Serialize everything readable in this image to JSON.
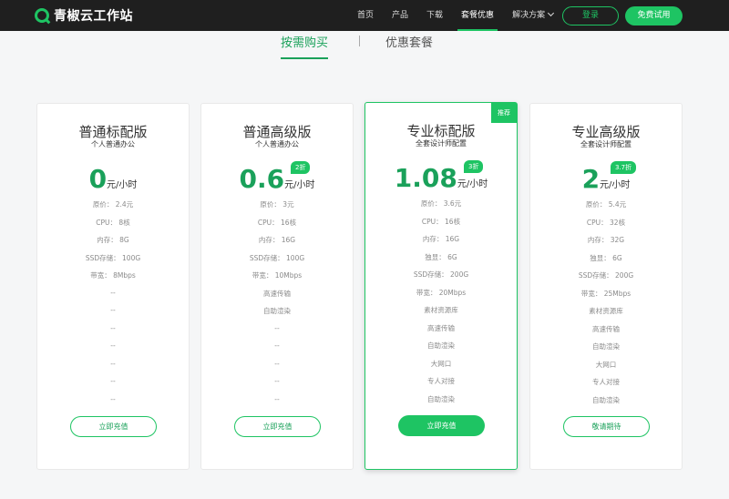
{
  "header": {
    "logo_text": "青椒云工作站",
    "nav": [
      "首页",
      "产品",
      "下载",
      "套餐优惠",
      "解决方案"
    ],
    "login": "登录",
    "trial": "免费试用"
  },
  "tabs": [
    "按需购买",
    "优惠套餐"
  ],
  "plans": [
    {
      "title": "普通标配版",
      "subtitle": "个人普通办公",
      "price": "0",
      "unit": "元/小时",
      "discount": "",
      "features": [
        "原价： 2.4元",
        "CPU： 8核",
        "内存： 8G",
        "SSD存储： 100G",
        "带宽： 8Mbps",
        "--",
        "--",
        "--",
        "--",
        "--",
        "--",
        "--"
      ],
      "button": "立即充值"
    },
    {
      "title": "普通高级版",
      "subtitle": "个人普通办公",
      "price": "0.6",
      "unit": "元/小时",
      "discount": "2折",
      "features": [
        "原价： 3元",
        "CPU： 16核",
        "内存： 16G",
        "SSD存储： 100G",
        "带宽： 10Mbps",
        "高速传输",
        "自助渲染",
        "--",
        "--",
        "--",
        "--",
        "--"
      ],
      "button": "立即充值"
    },
    {
      "title": "专业标配版",
      "subtitle": "全套设计师配置",
      "price": "1.08",
      "unit": "元/小时",
      "discount": "3折",
      "recommended": "推荐",
      "features": [
        "原价： 3.6元",
        "CPU： 16核",
        "内存： 16G",
        "独显： 6G",
        "SSD存储： 200G",
        "带宽： 20Mbps",
        "素材资源库",
        "高速传输",
        "自助渲染",
        "大网口",
        "专人对接",
        "自助渲染"
      ],
      "button": "立即充值"
    },
    {
      "title": "专业高级版",
      "subtitle": "全套设计师配置",
      "price": "2",
      "unit": "元/小时",
      "discount": "3.7折",
      "features": [
        "原价： 5.4元",
        "CPU： 32核",
        "内存： 32G",
        "独显： 6G",
        "SSD存储： 200G",
        "带宽： 25Mbps",
        "素材资源库",
        "高速传输",
        "自助渲染",
        "大网口",
        "专人对接",
        "自助渲染"
      ],
      "button": "敬请期待"
    }
  ]
}
